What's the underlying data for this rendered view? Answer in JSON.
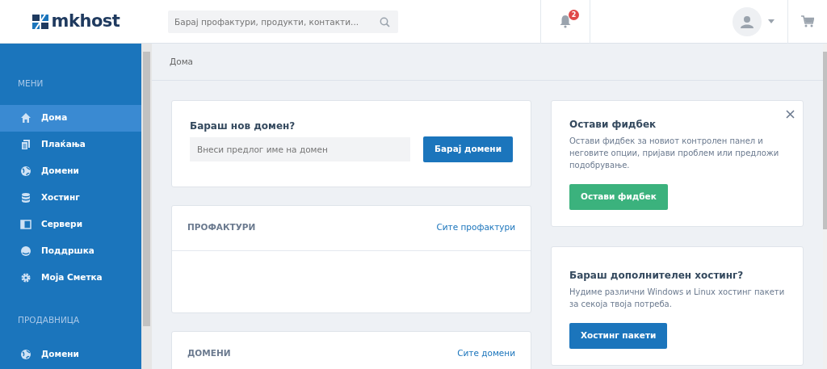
{
  "header": {
    "logo": "mkhost",
    "search": {
      "placeholder": "Барај профактури, продукти, контакти..."
    },
    "notifications": {
      "count": "2"
    }
  },
  "sidebar": {
    "sections": [
      {
        "title": "МЕНИ",
        "items": [
          {
            "label": "Дома",
            "selected": true
          },
          {
            "label": "Плаќања",
            "selected": false
          },
          {
            "label": "Домени",
            "selected": false
          },
          {
            "label": "Хостинг",
            "selected": false
          },
          {
            "label": "Сервери",
            "selected": false
          },
          {
            "label": "Поддршка",
            "selected": false
          },
          {
            "label": "Моја Сметка",
            "selected": false
          }
        ]
      },
      {
        "title": "ПРОДАВНИЦА",
        "items": [
          {
            "label": "Домени",
            "selected": false
          }
        ]
      }
    ]
  },
  "breadcrumb": "Дома",
  "domain_search": {
    "title": "Бараш нов домен?",
    "placeholder": "Внеси предлог име на домен",
    "button": "Барај домени"
  },
  "panels": [
    {
      "title": "ПРОФАКТУРИ",
      "link": "Сите профактури"
    },
    {
      "title": "ДОМЕНИ",
      "link": "Сите домени"
    }
  ],
  "promos": [
    {
      "title": "Остави фидбек",
      "text": "Остави фидбек за новиот контролен панел и неговите опции, пријави проблем или предложи подобрување.",
      "button": "Остави фидбек",
      "kind": "feedback",
      "dismissible": true
    },
    {
      "title": "Бараш дополнителен хостинг?",
      "text": "Нудиме различни Windows и Linux хостинг пакети за секоја твоја потреба.",
      "button": "Хостинг пакети",
      "kind": "hosting",
      "dismissible": false
    }
  ]
}
